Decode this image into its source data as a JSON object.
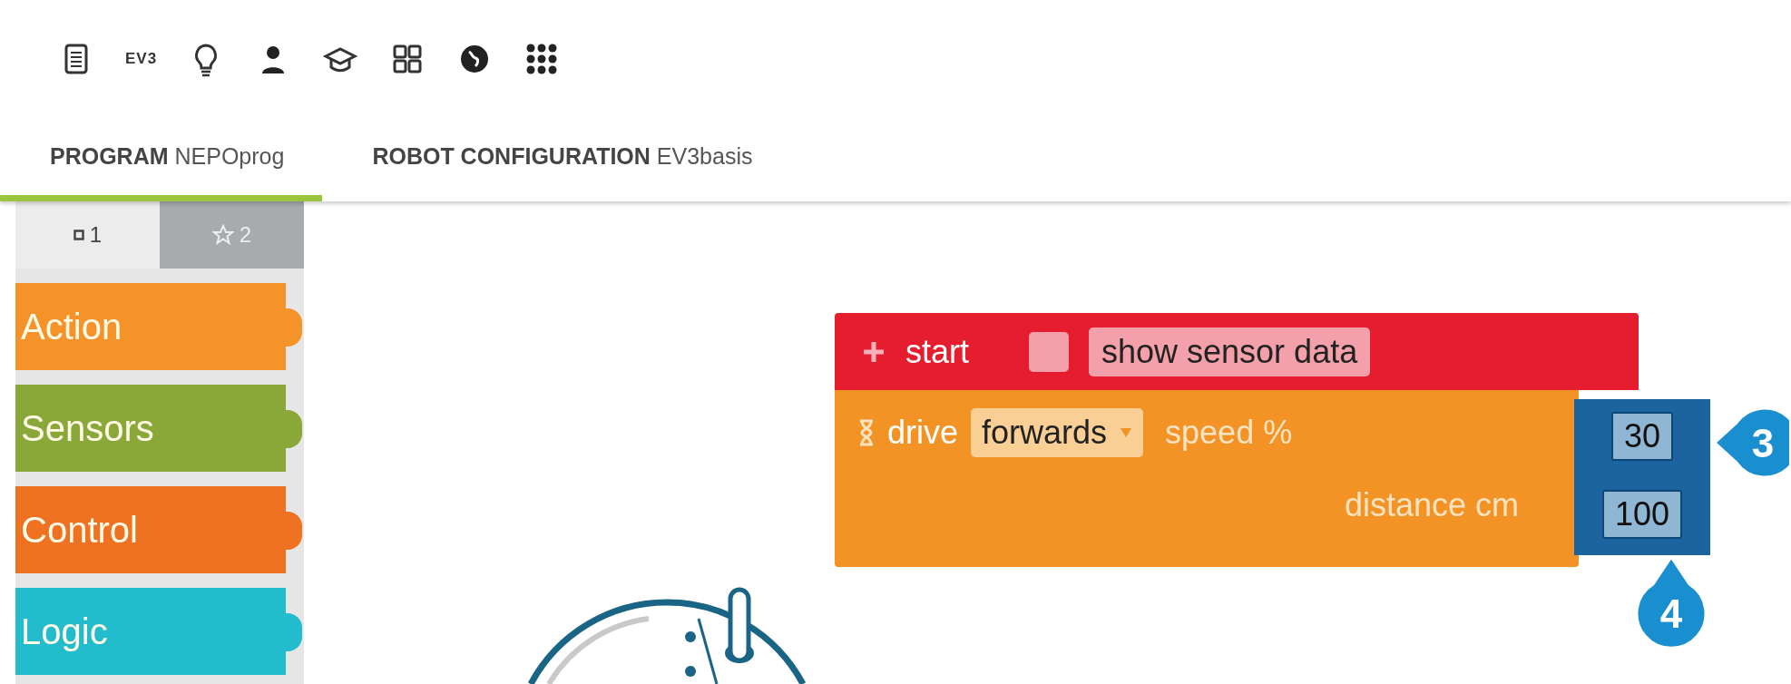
{
  "toolbar": {
    "logo_text": "EV3"
  },
  "tabs": [
    {
      "label": "**PROGRAM** NEPOprog",
      "selected": true
    },
    {
      "label": "**ROBOT CONFIGURATION** EV3basis",
      "selected": false
    }
  ],
  "palette": {
    "levels": [
      {
        "label": "1",
        "selected": true
      },
      {
        "label": "2",
        "selected": false
      }
    ],
    "categories": [
      {
        "label": "Action",
        "color": "#f5922a"
      },
      {
        "label": "Sensors",
        "color": "#8aa83a"
      },
      {
        "label": "Control",
        "color": "#ef7122"
      },
      {
        "label": "Logic",
        "color": "#22bccc"
      }
    ]
  },
  "program": {
    "start": {
      "label": "start",
      "show_sensor_data": {
        "label": "show sensor data",
        "checked": false
      }
    },
    "drive": {
      "label": "drive",
      "direction": "forwards",
      "speed_label": "speed %",
      "speed": "30",
      "distance_label": "distance cm",
      "distance": "100"
    }
  },
  "callouts": [
    "3",
    "4"
  ]
}
